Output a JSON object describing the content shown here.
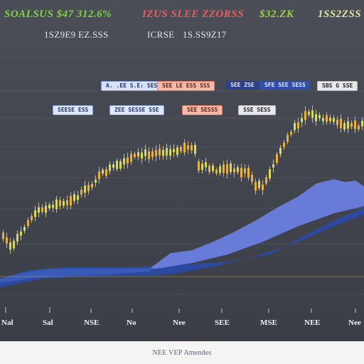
{
  "header": {
    "tickers": [
      {
        "label": "SOALSUS $47 312.6%",
        "color": "#7cd63c"
      },
      {
        "label": "IZUS SLEE ZZORSS",
        "color": "#ef5b5b"
      },
      {
        "label": "$32.ZK",
        "color": "#9ad637"
      },
      {
        "label": "1SS2ZSS",
        "color": "#dfe6a0"
      }
    ],
    "subtitles": [
      "1SZ9E9 EZ.SSS",
      "ICRSE",
      "1S.SS9Z17"
    ]
  },
  "tags": {
    "row1": [
      {
        "label": "A. .EE S.E: SES",
        "bg": "#d9e2f5",
        "fg": "#223366",
        "border": "#8aa0d8"
      },
      {
        "label": "SEE LE ESS SSS",
        "bg": "#f4b8a8",
        "fg": "#5a1f14",
        "border": "#e07a64"
      },
      {
        "label": "SEE ZSE",
        "bg": "#2c3e8c",
        "fg": "#e6ecff",
        "border": "#2c3e8c"
      },
      {
        "label": "SFE SEE SESS",
        "bg": "#2f4fb0",
        "fg": "#e6ecff",
        "border": "#2f4fb0"
      },
      {
        "label": "SBS G SSE",
        "bg": "#e8e8ec",
        "fg": "#222",
        "border": "#bbb"
      }
    ],
    "row2": [
      {
        "label": "SEESE ESS",
        "bg": "#dde6f7",
        "fg": "#223366",
        "border": "#8aa0d8"
      },
      {
        "label": "ZEE SESSE SSE",
        "bg": "#dfe7f8",
        "fg": "#223366",
        "border": "#8aa0d8"
      },
      {
        "label": "SEE SESSS",
        "bg": "#f4b8a8",
        "fg": "#5a1f14",
        "border": "#e07a64"
      },
      {
        "label": "SSE SESS",
        "bg": "#e8e8ec",
        "fg": "#222",
        "border": "#bbb"
      }
    ]
  },
  "xaxis": {
    "labels": [
      "Nal",
      "Sal",
      "NSE",
      "No",
      "Nee",
      "SEE",
      "MSE",
      "NEE",
      "Nee"
    ]
  },
  "footer": {
    "text": "NEE VEP Amendes"
  },
  "colors": {
    "bull": "#e9b040",
    "bear": "#d7d95a",
    "area_light": "#5b6fd6",
    "area_dark": "#1f3f8f"
  }
}
